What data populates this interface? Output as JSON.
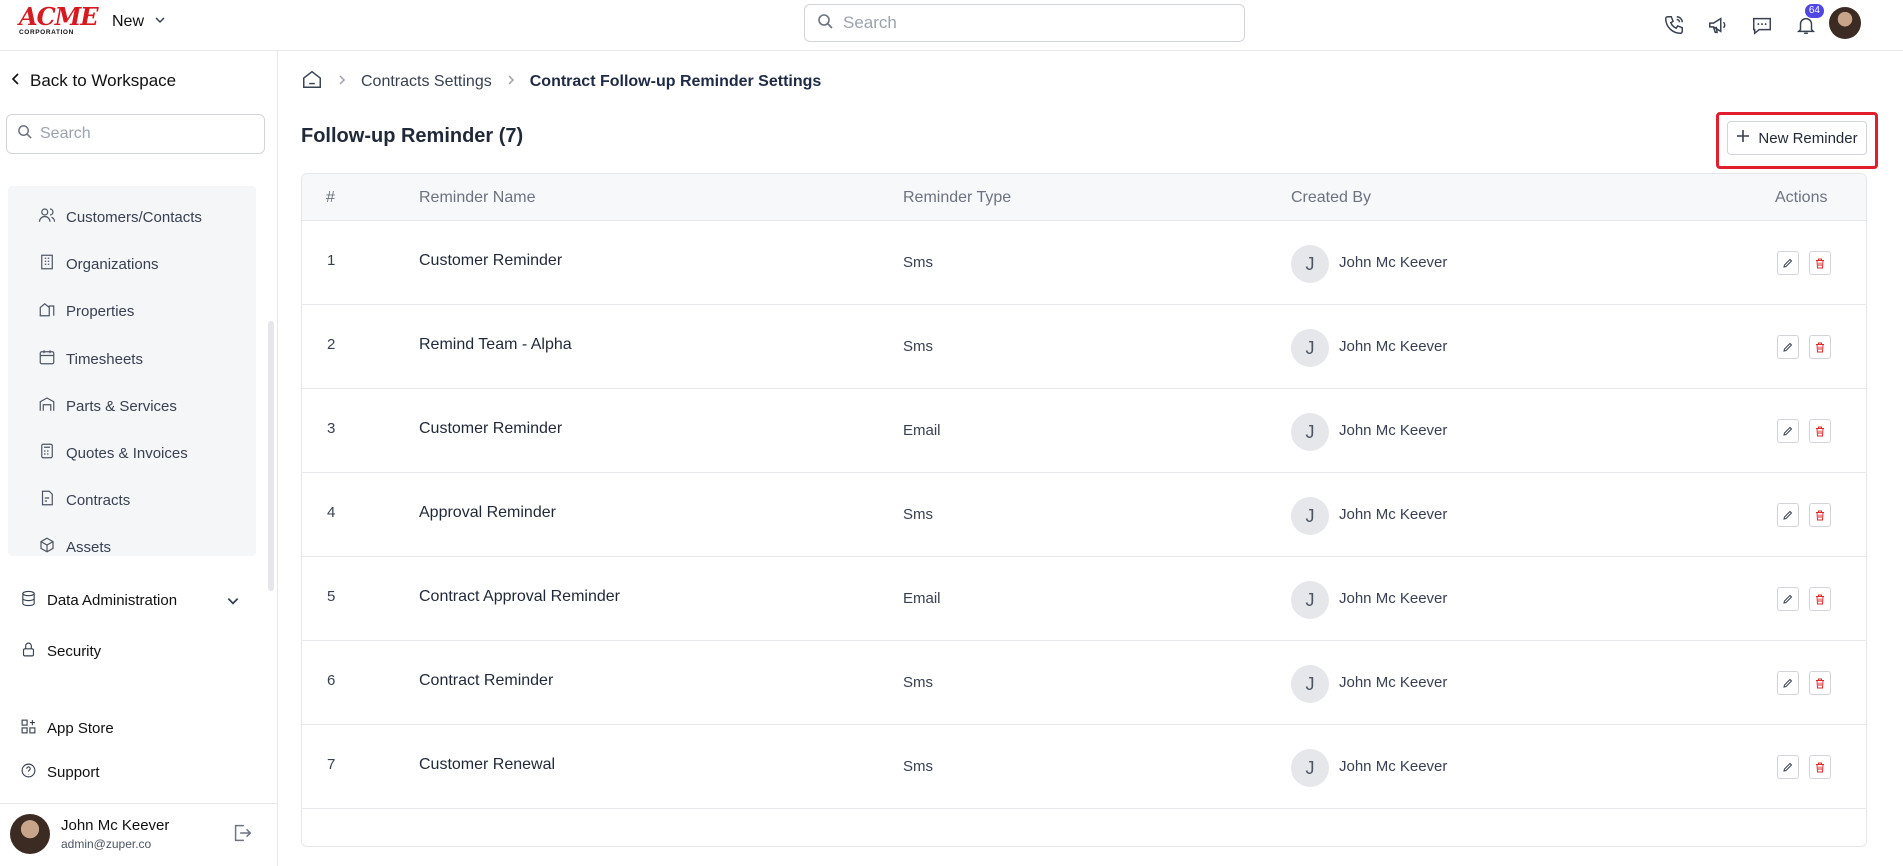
{
  "topbar": {
    "logo_big": "ACME",
    "logo_small": "CORPORATION",
    "new_label": "New",
    "search_placeholder": "Search",
    "notification_count": "64",
    "icons": [
      "phone-icon",
      "megaphone-icon",
      "chat-icon",
      "bell-icon"
    ]
  },
  "sidebar": {
    "back_label": "Back to Workspace",
    "search_placeholder": "Search",
    "subnav": [
      {
        "label": "Customers/Contacts",
        "icon": "users-icon"
      },
      {
        "label": "Organizations",
        "icon": "building-icon"
      },
      {
        "label": "Properties",
        "icon": "property-icon"
      },
      {
        "label": "Timesheets",
        "icon": "calendar-icon"
      },
      {
        "label": "Parts & Services",
        "icon": "warehouse-icon"
      },
      {
        "label": "Quotes & Invoices",
        "icon": "calculator-icon"
      },
      {
        "label": "Contracts",
        "icon": "contract-icon"
      },
      {
        "label": "Assets",
        "icon": "cube-icon"
      }
    ],
    "data_admin_label": "Data Administration",
    "security_label": "Security",
    "app_store_label": "App Store",
    "support_label": "Support",
    "user": {
      "name": "John Mc Keever",
      "email": "admin@zuper.co"
    }
  },
  "breadcrumb": {
    "parent": "Contracts Settings",
    "current": "Contract Follow-up Reminder Settings"
  },
  "page": {
    "title": "Follow-up Reminder (7)",
    "new_button_label": "New Reminder"
  },
  "table": {
    "headers": {
      "num": "#",
      "name": "Reminder Name",
      "type": "Reminder Type",
      "created_by": "Created By",
      "actions": "Actions"
    },
    "rows": [
      {
        "num": "1",
        "name": "Customer Reminder",
        "type": "Sms",
        "initial": "J",
        "created_by": "John Mc Keever"
      },
      {
        "num": "2",
        "name": "Remind Team - Alpha",
        "type": "Sms",
        "initial": "J",
        "created_by": "John Mc Keever"
      },
      {
        "num": "3",
        "name": "Customer Reminder",
        "type": "Email",
        "initial": "J",
        "created_by": "John Mc Keever"
      },
      {
        "num": "4",
        "name": "Approval Reminder",
        "type": "Sms",
        "initial": "J",
        "created_by": "John Mc Keever"
      },
      {
        "num": "5",
        "name": "Contract Approval Reminder",
        "type": "Email",
        "initial": "J",
        "created_by": "John Mc Keever"
      },
      {
        "num": "6",
        "name": "Contract Reminder",
        "type": "Sms",
        "initial": "J",
        "created_by": "John Mc Keever"
      },
      {
        "num": "7",
        "name": "Customer Renewal",
        "type": "Sms",
        "initial": "J",
        "created_by": "John Mc Keever"
      }
    ]
  },
  "colors": {
    "accent": "#e11d2e",
    "badge": "#4f46e5",
    "delete": "#dc2626"
  }
}
